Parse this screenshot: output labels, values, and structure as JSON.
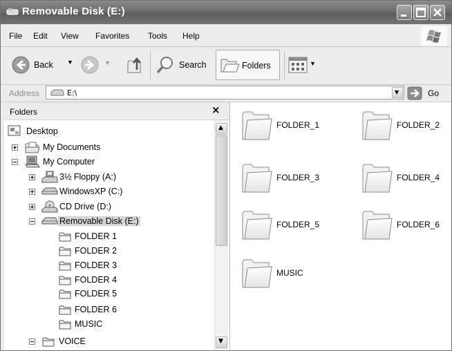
{
  "window": {
    "title": "Removable Disk (E:)"
  },
  "menu": [
    {
      "label": "File"
    },
    {
      "label": "Edit"
    },
    {
      "label": "View"
    },
    {
      "label": "Favorites"
    },
    {
      "label": "Tools"
    },
    {
      "label": "Help"
    }
  ],
  "toolbar": {
    "back_label": "Back",
    "search_label": "Search",
    "folders_label": "Folders"
  },
  "address": {
    "label": "Address",
    "value": "E:\\",
    "go_label": "Go"
  },
  "folders_pane": {
    "title": "Folders",
    "close_glyph": "×",
    "tree": [
      {
        "label": "Desktop"
      },
      {
        "label": "My Documents"
      },
      {
        "label": "My Computer"
      },
      {
        "label": "3½ Floppy (A:)"
      },
      {
        "label": "WindowsXP (C:)"
      },
      {
        "label": "CD Drive (D:)"
      },
      {
        "label": "Removable Disk (E:)"
      },
      {
        "label": "FOLDER 1"
      },
      {
        "label": "FOLDER 2"
      },
      {
        "label": "FOLDER 3"
      },
      {
        "label": "FOLDER 4"
      },
      {
        "label": "FOLDER 5"
      },
      {
        "label": "FOLDER 6"
      },
      {
        "label": "MUSIC"
      },
      {
        "label": "VOICE"
      }
    ]
  },
  "content": {
    "items": [
      {
        "label": "FOLDER_1"
      },
      {
        "label": "FOLDER_2"
      },
      {
        "label": "FOLDER_3"
      },
      {
        "label": "FOLDER_4"
      },
      {
        "label": "FOLDER_5"
      },
      {
        "label": "FOLDER_6"
      },
      {
        "label": "MUSIC"
      }
    ]
  },
  "icons": {
    "title": "drive-icon",
    "back": "back-arrow-icon",
    "forward": "forward-arrow-icon",
    "up": "up-folder-icon",
    "search": "search-icon",
    "folders": "folders-icon",
    "views": "views-icon"
  }
}
